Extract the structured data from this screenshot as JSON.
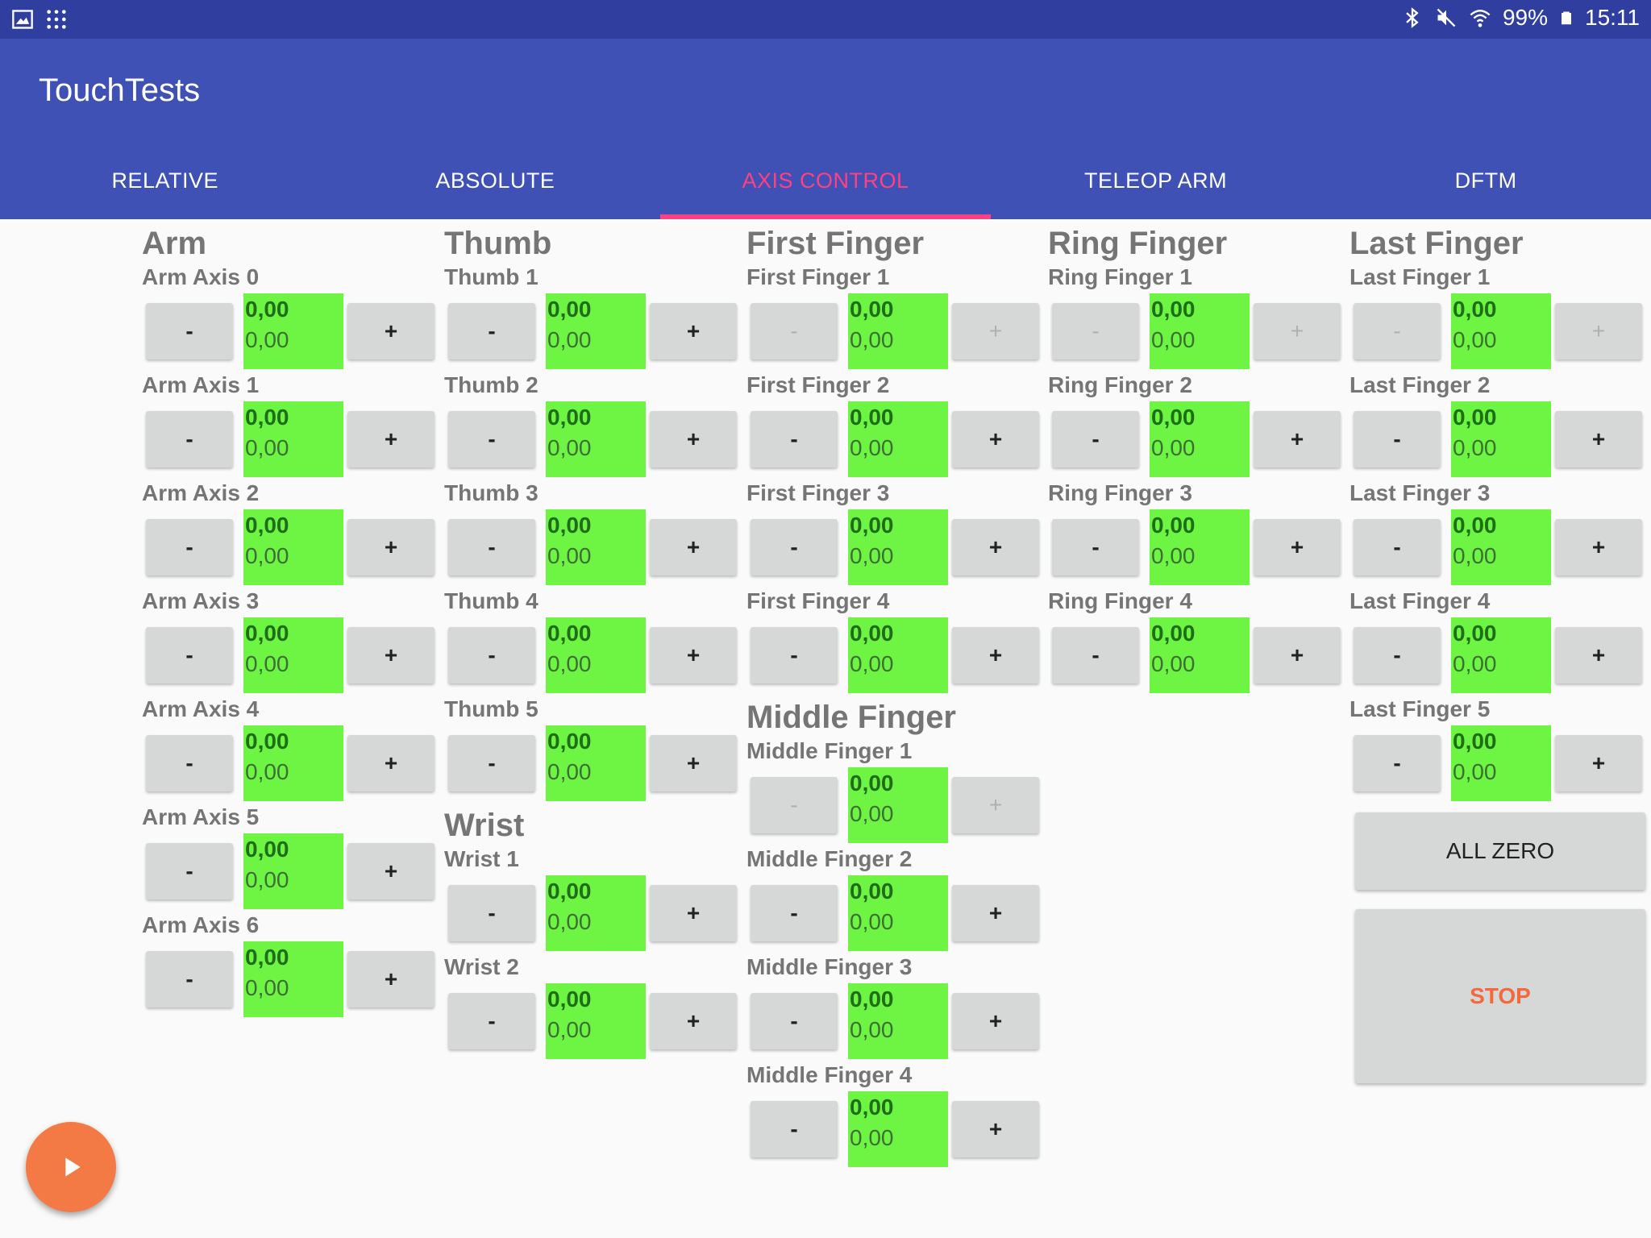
{
  "status_bar": {
    "left_icons": [
      "gallery-icon",
      "apps-grid-icon"
    ],
    "right_icons": [
      "bluetooth-icon",
      "mute-icon",
      "wifi-icon",
      "battery-icon"
    ],
    "battery": "99%",
    "time": "15:11"
  },
  "app_bar": {
    "title": "TouchTests",
    "color": "#3f51b5"
  },
  "tabs": [
    {
      "label": "RELATIVE",
      "active": false
    },
    {
      "label": "ABSOLUTE",
      "active": false
    },
    {
      "label": "AXIS CONTROL",
      "active": true
    },
    {
      "label": "TELEOP ARM",
      "active": false
    },
    {
      "label": "DFTM",
      "active": false
    }
  ],
  "buttons": {
    "minus_label": "-",
    "plus_label": "+"
  },
  "sections": {
    "arm": {
      "title": "Arm",
      "axes": [
        {
          "label": "Arm Axis 0",
          "target": "0,00",
          "actual": "0,00"
        },
        {
          "label": "Arm Axis 1",
          "target": "0,00",
          "actual": "0,00"
        },
        {
          "label": "Arm Axis 2",
          "target": "0,00",
          "actual": "0,00"
        },
        {
          "label": "Arm Axis 3",
          "target": "0,00",
          "actual": "0,00"
        },
        {
          "label": "Arm Axis 4",
          "target": "0,00",
          "actual": "0,00"
        },
        {
          "label": "Arm Axis 5",
          "target": "0,00",
          "actual": "0,00"
        },
        {
          "label": "Arm Axis 6",
          "target": "0,00",
          "actual": "0,00"
        }
      ]
    },
    "thumb": {
      "title": "Thumb",
      "axes": [
        {
          "label": "Thumb 1",
          "target": "0,00",
          "actual": "0,00"
        },
        {
          "label": "Thumb 2",
          "target": "0,00",
          "actual": "0,00"
        },
        {
          "label": "Thumb 3",
          "target": "0,00",
          "actual": "0,00"
        },
        {
          "label": "Thumb 4",
          "target": "0,00",
          "actual": "0,00"
        },
        {
          "label": "Thumb 5",
          "target": "0,00",
          "actual": "0,00"
        }
      ]
    },
    "wrist": {
      "title": "Wrist",
      "axes": [
        {
          "label": "Wrist 1",
          "target": "0,00",
          "actual": "0,00"
        },
        {
          "label": "Wrist 2",
          "target": "0,00",
          "actual": "0,00"
        }
      ]
    },
    "first_finger": {
      "title": "First Finger",
      "axes": [
        {
          "label": "First Finger 1",
          "target": "0,00",
          "actual": "0,00",
          "disabled": true
        },
        {
          "label": "First Finger 2",
          "target": "0,00",
          "actual": "0,00"
        },
        {
          "label": "First Finger 3",
          "target": "0,00",
          "actual": "0,00"
        },
        {
          "label": "First Finger 4",
          "target": "0,00",
          "actual": "0,00"
        }
      ]
    },
    "middle_finger": {
      "title": "Middle Finger",
      "axes": [
        {
          "label": "Middle Finger 1",
          "target": "0,00",
          "actual": "0,00",
          "disabled": true
        },
        {
          "label": "Middle Finger 2",
          "target": "0,00",
          "actual": "0,00"
        },
        {
          "label": "Middle Finger 3",
          "target": "0,00",
          "actual": "0,00"
        },
        {
          "label": "Middle Finger 4",
          "target": "0,00",
          "actual": "0,00"
        }
      ]
    },
    "ring_finger": {
      "title": "Ring Finger",
      "axes": [
        {
          "label": "Ring Finger 1",
          "target": "0,00",
          "actual": "0,00",
          "disabled": true
        },
        {
          "label": "Ring Finger 2",
          "target": "0,00",
          "actual": "0,00"
        },
        {
          "label": "Ring Finger 3",
          "target": "0,00",
          "actual": "0,00"
        },
        {
          "label": "Ring Finger 4",
          "target": "0,00",
          "actual": "0,00"
        }
      ]
    },
    "last_finger": {
      "title": "Last Finger",
      "axes": [
        {
          "label": "Last Finger 1",
          "target": "0,00",
          "actual": "0,00",
          "disabled": true
        },
        {
          "label": "Last Finger 2",
          "target": "0,00",
          "actual": "0,00"
        },
        {
          "label": "Last Finger 3",
          "target": "0,00",
          "actual": "0,00"
        },
        {
          "label": "Last Finger 4",
          "target": "0,00",
          "actual": "0,00"
        },
        {
          "label": "Last Finger 5",
          "target": "0,00",
          "actual": "0,00"
        }
      ]
    }
  },
  "actions": {
    "all_zero": "ALL ZERO",
    "stop": "STOP",
    "stop_color": "#f4693b"
  },
  "fab": {
    "icon": "play-icon",
    "color": "#f47a45"
  }
}
